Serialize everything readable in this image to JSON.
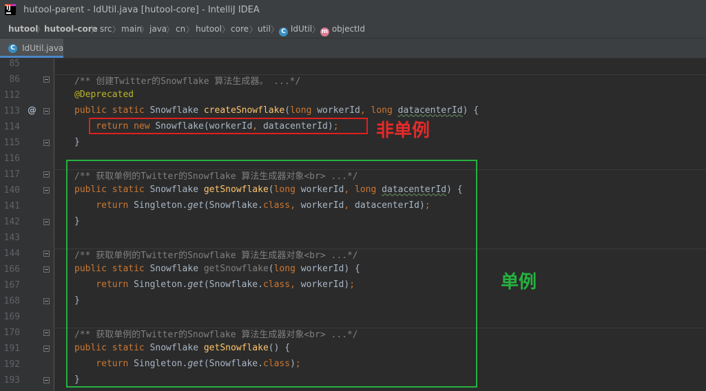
{
  "window": {
    "title": "hutool-parent - IdUtil.java [hutool-core] - IntelliJ IDEA",
    "app_icon": "intellij-icon"
  },
  "breadcrumb": {
    "items": [
      "hutool",
      "hutool-core",
      "src",
      "main",
      "java",
      "cn",
      "hutool",
      "core",
      "util",
      "IdUtil",
      "objectId"
    ],
    "class_icon": "C",
    "method_icon": "m"
  },
  "tab": {
    "label": "IdUtil.java",
    "icon": "C"
  },
  "annotations": {
    "not_singleton": "非单例",
    "singleton": "单例"
  },
  "colors": {
    "red_box": "#e02020",
    "green_box": "#25b23f",
    "accent": "#4a88c7"
  },
  "lines": [
    {
      "num": "85",
      "tokens": []
    },
    {
      "num": "86",
      "fold": true,
      "tokens": [
        {
          "t": "/** 创建Twitter的Snowflake 算法生成器。 ...*/",
          "c": "cm"
        }
      ]
    },
    {
      "num": "112",
      "tokens": [
        {
          "t": "@Deprecated",
          "c": "ann"
        }
      ]
    },
    {
      "num": "113",
      "fold": true,
      "at": true,
      "tokens": [
        {
          "t": "public static ",
          "c": "kw"
        },
        {
          "t": "Snowflake ",
          "c": ""
        },
        {
          "t": "createSnowflake",
          "c": "fn"
        },
        {
          "t": "(",
          "c": ""
        },
        {
          "t": "long ",
          "c": "kw"
        },
        {
          "t": "workerId",
          "c": ""
        },
        {
          "t": ", ",
          "c": "kw"
        },
        {
          "t": "long ",
          "c": "kw"
        },
        {
          "t": "datacenterId",
          "c": "wavy"
        },
        {
          "t": ") {",
          "c": ""
        }
      ]
    },
    {
      "num": "114",
      "tokens": [
        {
          "t": "    return new ",
          "c": "kw"
        },
        {
          "t": "Snowflake(workerId",
          "c": ""
        },
        {
          "t": ", ",
          "c": "kw"
        },
        {
          "t": "datacenterId)",
          "c": ""
        },
        {
          "t": ";",
          "c": "kw"
        }
      ]
    },
    {
      "num": "115",
      "fold": true,
      "tokens": [
        {
          "t": "}",
          "c": ""
        }
      ]
    },
    {
      "num": "116",
      "tokens": []
    },
    {
      "num": "117",
      "fold": true,
      "tokens": [
        {
          "t": "/** 获取单例的Twitter的Snowflake 算法生成器对象<br> ...*/",
          "c": "cm"
        }
      ]
    },
    {
      "num": "140",
      "fold": true,
      "tokens": [
        {
          "t": "public static ",
          "c": "kw"
        },
        {
          "t": "Snowflake ",
          "c": ""
        },
        {
          "t": "getSnowflake",
          "c": "fn"
        },
        {
          "t": "(",
          "c": ""
        },
        {
          "t": "long ",
          "c": "kw"
        },
        {
          "t": "workerId",
          "c": ""
        },
        {
          "t": ", ",
          "c": "kw"
        },
        {
          "t": "long ",
          "c": "kw"
        },
        {
          "t": "datacenterId",
          "c": "wavy"
        },
        {
          "t": ") {",
          "c": ""
        }
      ]
    },
    {
      "num": "141",
      "tokens": [
        {
          "t": "    return ",
          "c": "kw"
        },
        {
          "t": "Singleton.",
          "c": ""
        },
        {
          "t": "get",
          "c": "it"
        },
        {
          "t": "(Snowflake.",
          "c": ""
        },
        {
          "t": "class",
          "c": "kw"
        },
        {
          "t": ", ",
          "c": "kw"
        },
        {
          "t": "workerId",
          "c": ""
        },
        {
          "t": ", ",
          "c": "kw"
        },
        {
          "t": "datacenterId)",
          "c": ""
        },
        {
          "t": ";",
          "c": "kw"
        }
      ]
    },
    {
      "num": "142",
      "fold": true,
      "tokens": [
        {
          "t": "}",
          "c": ""
        }
      ]
    },
    {
      "num": "143",
      "tokens": []
    },
    {
      "num": "144",
      "fold": true,
      "tokens": [
        {
          "t": "/** 获取单例的Twitter的Snowflake 算法生成器对象<br> ...*/",
          "c": "cm"
        }
      ]
    },
    {
      "num": "166",
      "fold": true,
      "tokens": [
        {
          "t": "public static ",
          "c": "kw"
        },
        {
          "t": "Snowflake ",
          "c": ""
        },
        {
          "t": "getSnowflake",
          "c": "cm"
        },
        {
          "t": "(",
          "c": ""
        },
        {
          "t": "long ",
          "c": "kw"
        },
        {
          "t": "workerId",
          "c": ""
        },
        {
          "t": ") {",
          "c": ""
        }
      ]
    },
    {
      "num": "167",
      "tokens": [
        {
          "t": "    return ",
          "c": "kw"
        },
        {
          "t": "Singleton.",
          "c": ""
        },
        {
          "t": "get",
          "c": "it"
        },
        {
          "t": "(Snowflake.",
          "c": ""
        },
        {
          "t": "class",
          "c": "kw"
        },
        {
          "t": ", ",
          "c": "kw"
        },
        {
          "t": "workerId)",
          "c": ""
        },
        {
          "t": ";",
          "c": "kw"
        }
      ]
    },
    {
      "num": "168",
      "fold": true,
      "tokens": [
        {
          "t": "}",
          "c": ""
        }
      ]
    },
    {
      "num": "169",
      "tokens": []
    },
    {
      "num": "170",
      "fold": true,
      "tokens": [
        {
          "t": "/** 获取单例的Twitter的Snowflake 算法生成器对象<br> ...*/",
          "c": "cm"
        }
      ]
    },
    {
      "num": "191",
      "fold": true,
      "tokens": [
        {
          "t": "public static ",
          "c": "kw"
        },
        {
          "t": "Snowflake ",
          "c": ""
        },
        {
          "t": "getSnowflake",
          "c": "fn"
        },
        {
          "t": "() {",
          "c": ""
        }
      ]
    },
    {
      "num": "192",
      "tokens": [
        {
          "t": "    return ",
          "c": "kw"
        },
        {
          "t": "Singleton.",
          "c": ""
        },
        {
          "t": "get",
          "c": "it"
        },
        {
          "t": "(Snowflake.",
          "c": ""
        },
        {
          "t": "class",
          "c": "kw"
        },
        {
          "t": ")",
          "c": ""
        },
        {
          "t": ";",
          "c": "kw"
        }
      ]
    },
    {
      "num": "193",
      "fold": true,
      "tokens": [
        {
          "t": "}",
          "c": ""
        }
      ]
    }
  ]
}
